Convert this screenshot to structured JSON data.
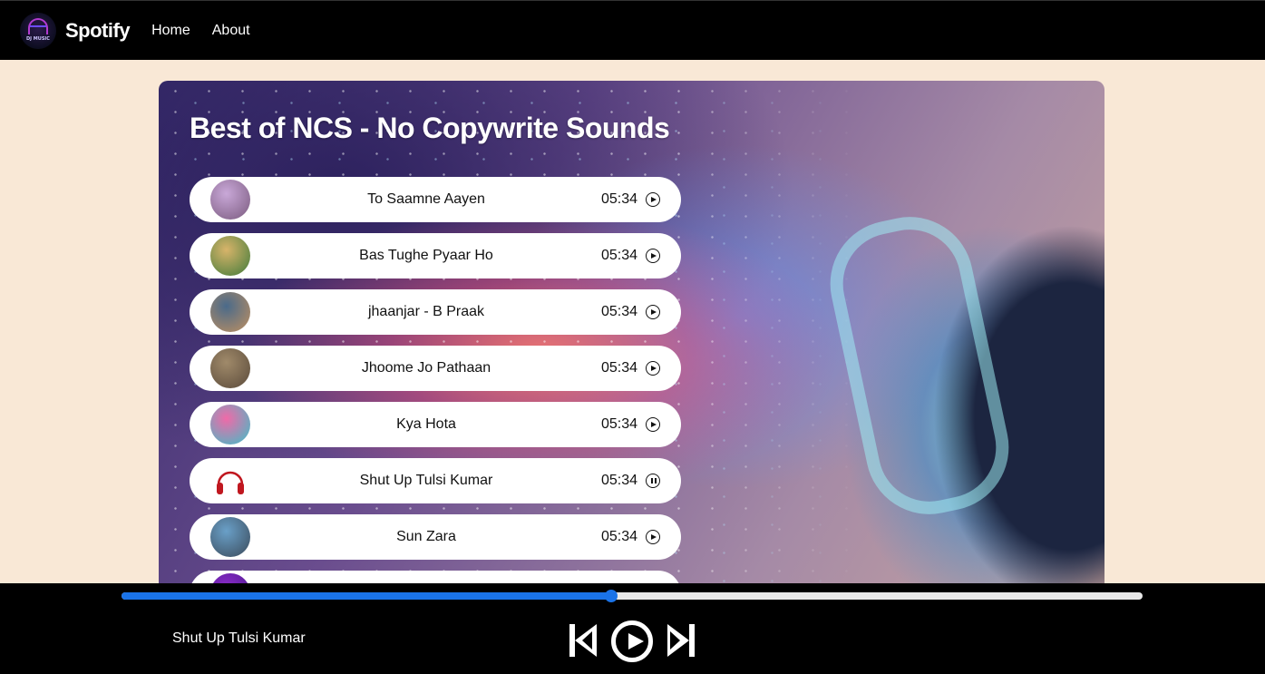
{
  "nav": {
    "logo_text": "DJ MUSIC",
    "brand": "Spotify",
    "links": [
      "Home",
      "About"
    ]
  },
  "playlist": {
    "title": "Best of NCS - No Copywrite Sounds",
    "songs": [
      {
        "name": "To Saamne Aayen",
        "duration": "05:34",
        "state": "play",
        "cover": [
          "#c9a8d8",
          "#7a5a7e"
        ]
      },
      {
        "name": "Bas Tughe Pyaar Ho",
        "duration": "05:34",
        "state": "play",
        "cover": [
          "#d8b46a",
          "#3f7a3a"
        ]
      },
      {
        "name": "jhaanjar - B Praak",
        "duration": "05:34",
        "state": "play",
        "cover": [
          "#4a6a8a",
          "#c09060"
        ]
      },
      {
        "name": "Jhoome Jo Pathaan",
        "duration": "05:34",
        "state": "play",
        "cover": [
          "#a08a6a",
          "#5a4a3a"
        ]
      },
      {
        "name": "Kya Hota",
        "duration": "05:34",
        "state": "play",
        "cover": [
          "#f06aa8",
          "#3ac0c8"
        ]
      },
      {
        "name": "Shut Up Tulsi Kumar",
        "duration": "05:34",
        "state": "pause",
        "cover": [
          "#ffffff",
          "#c0171f"
        ]
      },
      {
        "name": "Sun Zara",
        "duration": "05:34",
        "state": "play",
        "cover": [
          "#6aa0c8",
          "#3a4a5a"
        ]
      },
      {
        "name": "",
        "duration": "",
        "state": "",
        "cover": [
          "#8a2ac8",
          "#4a1a8a"
        ]
      }
    ]
  },
  "player": {
    "now_playing": "Shut Up Tulsi Kumar",
    "progress": 0.48,
    "accent_color": "#1a73e8",
    "icons": [
      "skip-previous-icon",
      "play-circle-icon",
      "skip-next-icon"
    ]
  }
}
